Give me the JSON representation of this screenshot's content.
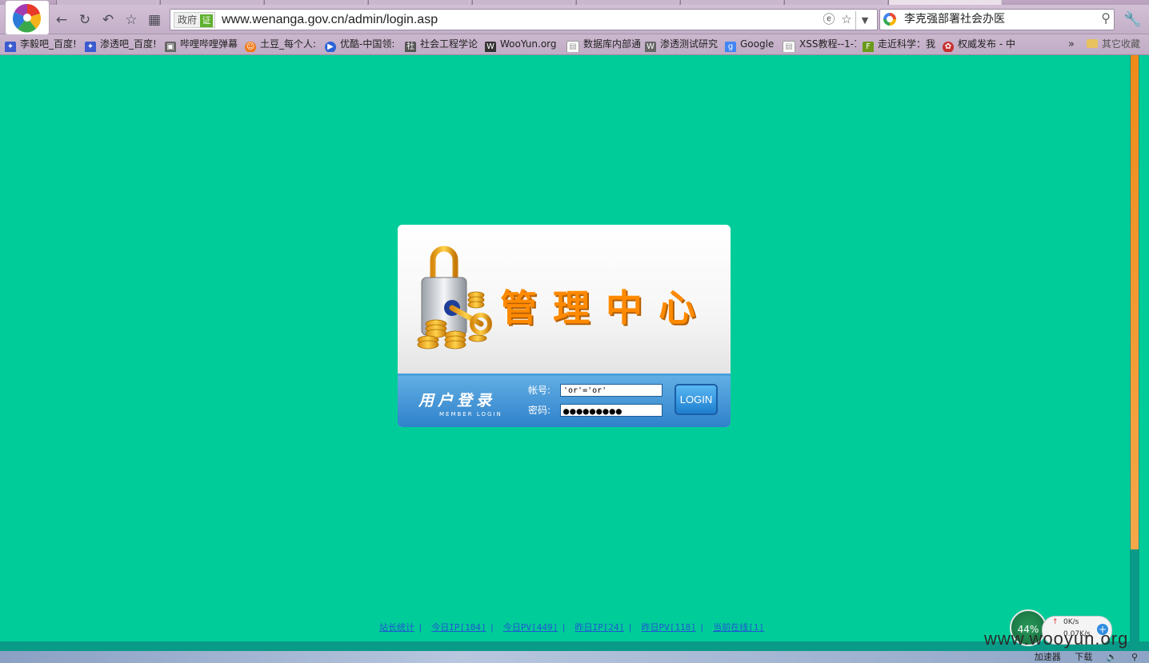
{
  "browser": {
    "address": {
      "gov_badge": "政府",
      "verified": "证",
      "url": "www.wenanga.gov.cn/admin/login.asp"
    },
    "search": {
      "text": "李克强部署社会办医"
    },
    "bookmarks": [
      {
        "label": "李毅吧_百度!",
        "color": "#3b5bd0"
      },
      {
        "label": "渗透吧_百度!",
        "color": "#3b5bd0"
      },
      {
        "label": "哔哩哔哩弹幕",
        "color": "#666666"
      },
      {
        "label": "土豆_每个人:",
        "color": "#f07a1a"
      },
      {
        "label": "优酷-中国领:",
        "color": "#2a62d6"
      },
      {
        "label": "社会工程学论",
        "color": "#555555"
      },
      {
        "label": "WooYun.org",
        "color": "#333333"
      },
      {
        "label": "数据库内部通",
        "color": "#888888"
      },
      {
        "label": "渗透测试研究",
        "color": "#666666"
      },
      {
        "label": "Google",
        "color": "#4285f4"
      },
      {
        "label": "XSS教程--1-1",
        "color": "#888888"
      },
      {
        "label": "走近科学：我",
        "color": "#6a9a1a"
      },
      {
        "label": "权威发布 - 中",
        "color": "#c83030"
      }
    ],
    "bookmarks_more": "»",
    "bookmarks_other": "其它收藏"
  },
  "login": {
    "title": "管理中心",
    "section_cn": "用户登录",
    "section_en": "MEMBER LOGIN",
    "account_label": "帐号:",
    "account_value": "'or'='or'",
    "password_label": "密码:",
    "password_value": "●●●●●●●●●",
    "login_button": "LOGIN"
  },
  "stats": [
    "站长统计",
    "今日IP[104]",
    "今日PV[449]",
    "昨日IP[24]",
    "昨日PV[118]",
    "当前在线[1]"
  ],
  "speed_widget": {
    "percent": "44%",
    "up": "0K/s",
    "down": "0.07K/s"
  },
  "status_bar": {
    "accelerator": "加速器",
    "download": "下载"
  },
  "watermark": "www.wooyun.org"
}
